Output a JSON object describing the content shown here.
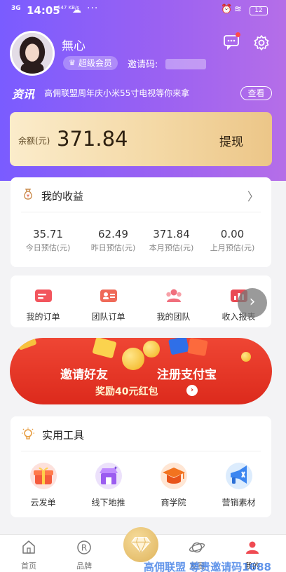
{
  "status_bar": {
    "signal": "3G",
    "time": "14:05",
    "net_speed": "547 KB/s",
    "battery": "12"
  },
  "profile": {
    "username": "無心",
    "member_level": "超级会员",
    "invite_label": "邀请码:",
    "invite_code": ""
  },
  "news": {
    "tag": "资讯",
    "text": "高佣联盟周年庆小米55寸电视等你来拿",
    "view_label": "查看"
  },
  "balance": {
    "label": "余额(元)",
    "value": "371.84",
    "withdraw_label": "提现"
  },
  "earnings": {
    "title": "我的收益",
    "stats": [
      {
        "value": "35.71",
        "label": "今日预估(元)"
      },
      {
        "value": "62.49",
        "label": "昨日预估(元)"
      },
      {
        "value": "371.84",
        "label": "本月预估(元)"
      },
      {
        "value": "0.00",
        "label": "上月预估(元)"
      }
    ]
  },
  "orders": {
    "items": [
      {
        "label": "我的订单",
        "icon": "order-icon"
      },
      {
        "label": "团队订单",
        "icon": "team-order-icon"
      },
      {
        "label": "我的团队",
        "icon": "team-icon"
      },
      {
        "label": "收入报表",
        "icon": "report-icon"
      }
    ]
  },
  "banner": {
    "line1_left": "邀请好友",
    "line1_right": "注册支付宝",
    "line2": "奖励40元红包"
  },
  "tools": {
    "title": "实用工具",
    "items": [
      {
        "label": "云发单",
        "icon": "gift-icon"
      },
      {
        "label": "线下地推",
        "icon": "store-icon"
      },
      {
        "label": "商学院",
        "icon": "graduation-cap-icon"
      },
      {
        "label": "营销素材",
        "icon": "megaphone-icon"
      }
    ]
  },
  "tabbar": {
    "items": [
      {
        "label": "首页",
        "icon": "home-icon"
      },
      {
        "label": "品牌",
        "icon": "brand-icon"
      },
      {
        "label": "",
        "icon": "diamond-icon"
      },
      {
        "label": "发圈",
        "icon": "planet-icon"
      },
      {
        "label": "我的",
        "icon": "profile-icon"
      }
    ]
  },
  "watermark": "高佣联盟 尊贵邀请码1688",
  "colors": {
    "header_start": "#7a5cff",
    "header_end": "#b56ee8",
    "accent_red": "#e93b2d",
    "gold": "#ecc688"
  }
}
